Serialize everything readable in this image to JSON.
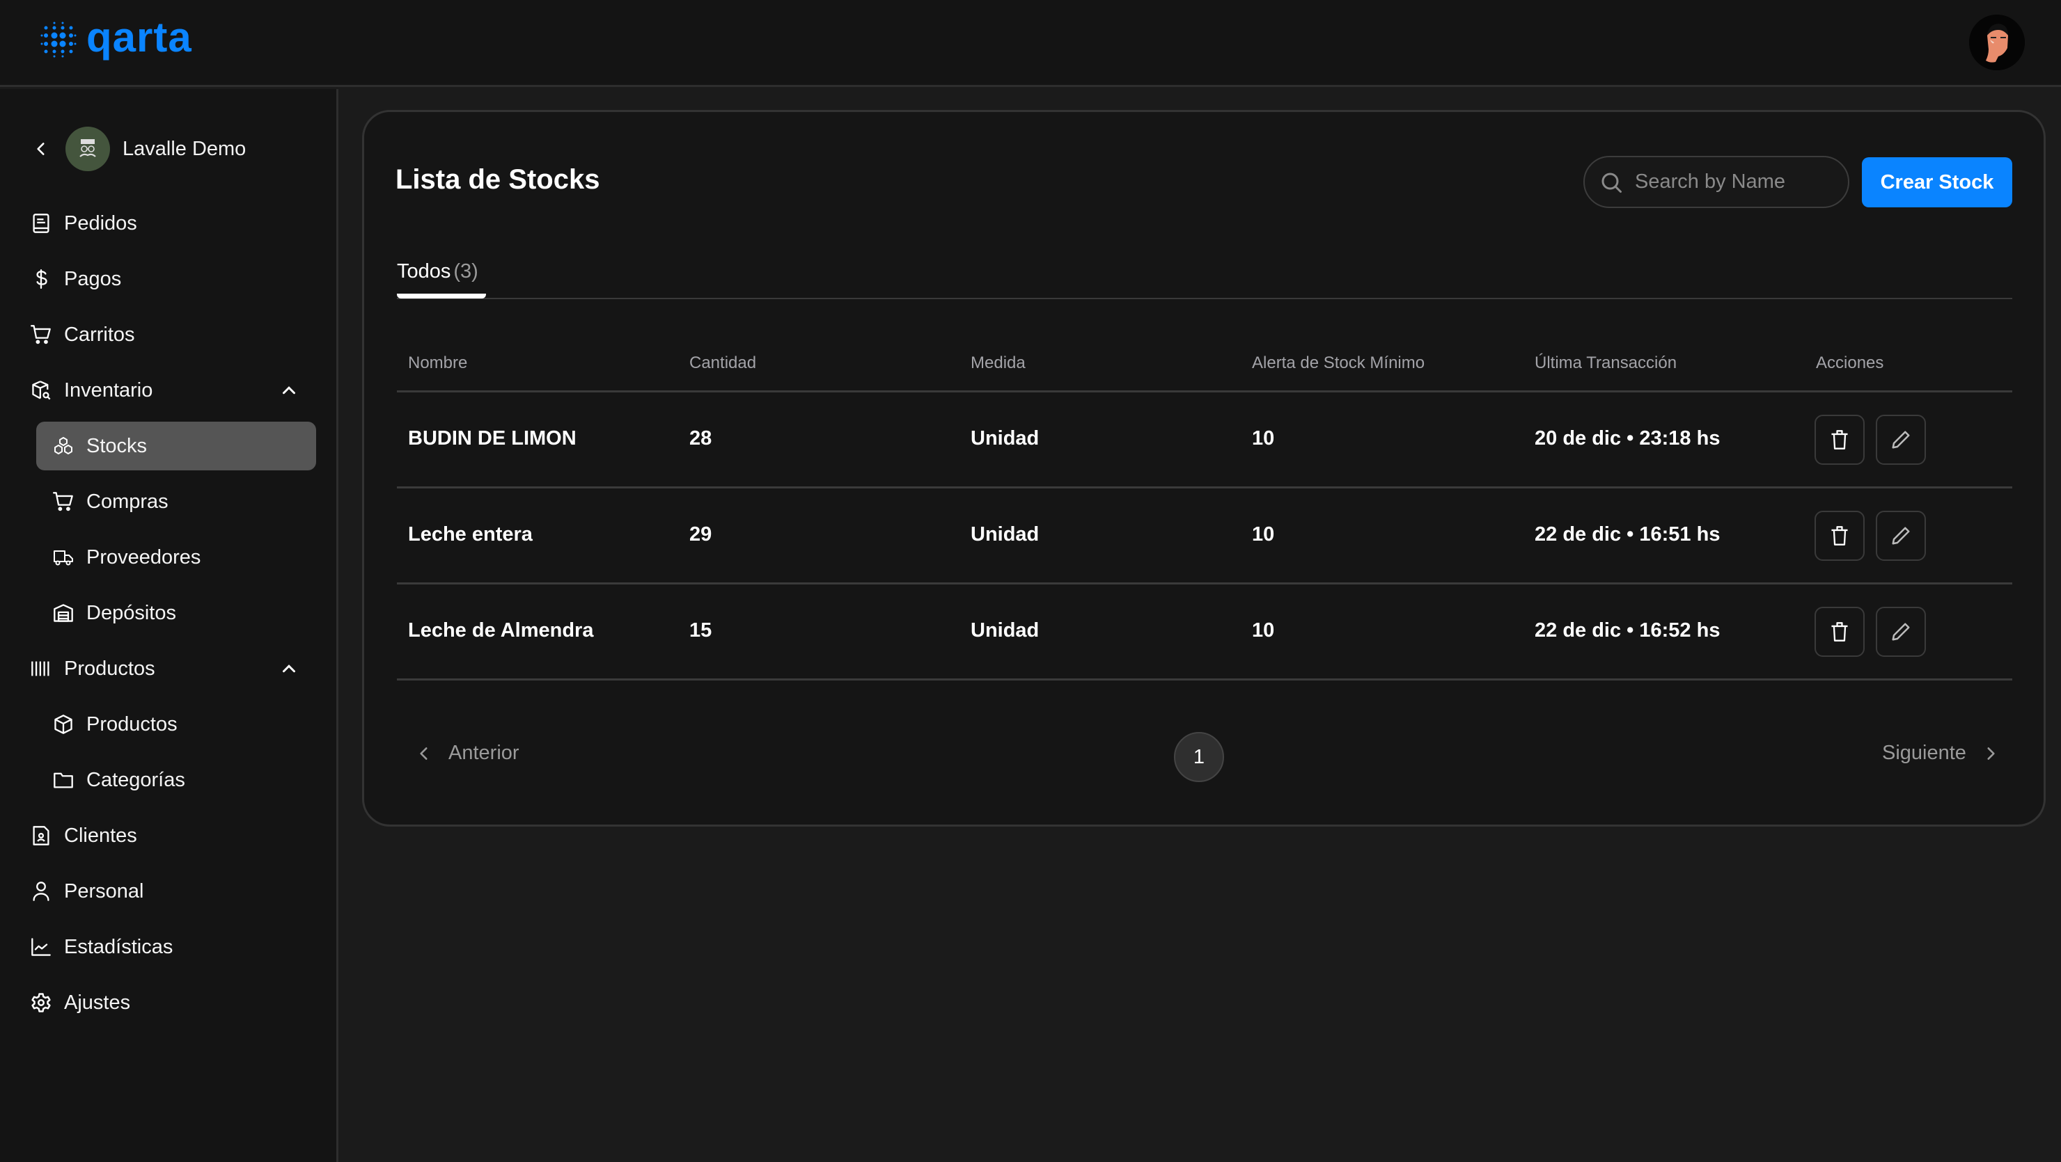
{
  "app": {
    "logo_text": "qarta",
    "brand_color": "#0a84ff"
  },
  "header": {
    "user_avatar_alt": "user avatar"
  },
  "sidebar": {
    "org_name": "Lavalle Demo",
    "items": {
      "pedidos": "Pedidos",
      "pagos": "Pagos",
      "carritos": "Carritos",
      "inventario": "Inventario",
      "stocks": "Stocks",
      "compras": "Compras",
      "proveedores": "Proveedores",
      "depositos": "Depósitos",
      "productos_group": "Productos",
      "productos": "Productos",
      "categorias": "Categorías",
      "clientes": "Clientes",
      "personal": "Personal",
      "estadisticas": "Estadísticas",
      "ajustes": "Ajustes"
    },
    "active_item": "Stocks"
  },
  "main": {
    "title": "Lista de Stocks",
    "search": {
      "placeholder": "Search by Name",
      "value": ""
    },
    "create_button": "Crear Stock",
    "tabs": [
      {
        "label": "Todos",
        "count": "(3)",
        "active": true
      }
    ],
    "table": {
      "columns": [
        "Nombre",
        "Cantidad",
        "Medida",
        "Alerta de Stock Mínimo",
        "Última Transacción",
        "Acciones"
      ],
      "rows": [
        {
          "nombre": "BUDIN DE LIMON",
          "cantidad": "28",
          "medida": "Unidad",
          "alerta": "10",
          "ultima": "20 de dic • 23:18 hs"
        },
        {
          "nombre": "Leche entera",
          "cantidad": "29",
          "medida": "Unidad",
          "alerta": "10",
          "ultima": "22 de dic • 16:51 hs"
        },
        {
          "nombre": "Leche de Almendra",
          "cantidad": "15",
          "medida": "Unidad",
          "alerta": "10",
          "ultima": "22 de dic • 16:52 hs"
        }
      ]
    },
    "pagination": {
      "prev_label": "Anterior",
      "next_label": "Siguiente",
      "current_page": "1"
    }
  }
}
